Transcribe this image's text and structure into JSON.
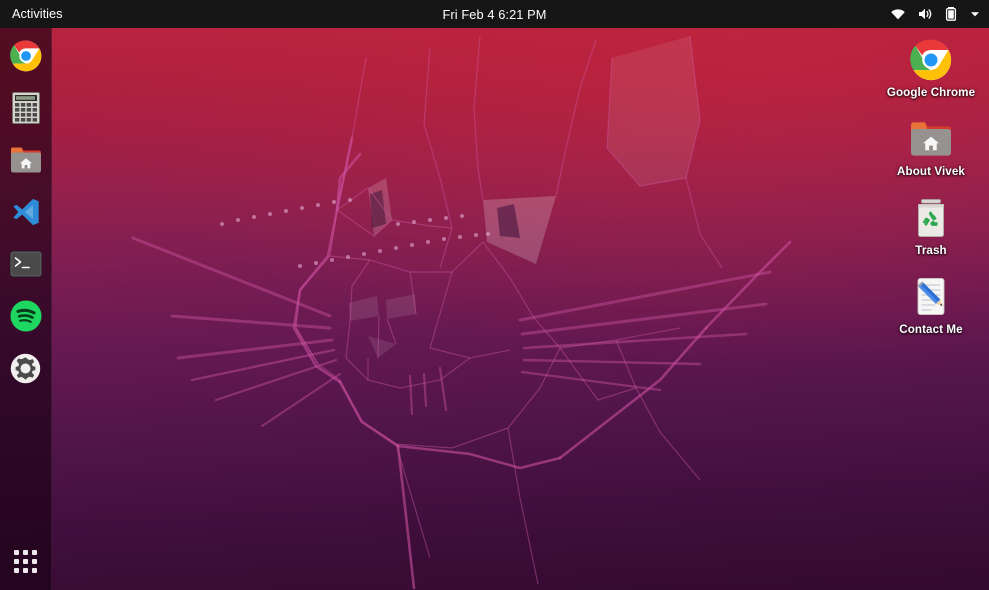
{
  "topbar": {
    "activities_label": "Activities",
    "clock": "Fri Feb 4 6:21 PM",
    "status_icons": [
      {
        "name": "wifi-icon",
        "label": "Wi-Fi"
      },
      {
        "name": "volume-icon",
        "label": "Volume"
      },
      {
        "name": "battery-icon",
        "label": "Battery"
      },
      {
        "name": "chevron-down-icon",
        "label": "System menu"
      }
    ],
    "background_color": "#161616",
    "text_color": "#ffffff"
  },
  "dock": {
    "background_color": "rgba(23,0,18,0.62)",
    "items": [
      {
        "name": "google-chrome",
        "label": "Google Chrome",
        "icon": "chrome-icon"
      },
      {
        "name": "calculator",
        "label": "Calculator",
        "icon": "calculator-icon"
      },
      {
        "name": "files",
        "label": "Files",
        "icon": "home-folder-icon"
      },
      {
        "name": "visual-studio-code",
        "label": "Visual Studio Code",
        "icon": "vscode-icon"
      },
      {
        "name": "terminal",
        "label": "Terminal",
        "icon": "terminal-icon"
      },
      {
        "name": "spotify",
        "label": "Spotify",
        "icon": "spotify-icon"
      },
      {
        "name": "settings",
        "label": "Settings",
        "icon": "gear-icon"
      }
    ],
    "app_grid": {
      "name": "show-applications",
      "label": "Show Applications",
      "icon": "grid-dots-icon"
    }
  },
  "desktop": {
    "wallpaper": {
      "name": "ubuntu-jammy-cougar-wallpaper",
      "description": "Low-poly geometric cougar head line art",
      "gradient_top": "#b8243f",
      "gradient_bottom": "#340a31",
      "line_color": "#c44a9e"
    },
    "icons": [
      {
        "name": "desktop-icon-google-chrome",
        "label": "Google Chrome",
        "icon": "chrome-icon"
      },
      {
        "name": "desktop-icon-about-vivek",
        "label": "About Vivek",
        "icon": "home-folder-icon"
      },
      {
        "name": "desktop-icon-trash",
        "label": "Trash",
        "icon": "trash-icon"
      },
      {
        "name": "desktop-icon-contact-me",
        "label": "Contact Me",
        "icon": "note-pencil-icon"
      }
    ]
  }
}
